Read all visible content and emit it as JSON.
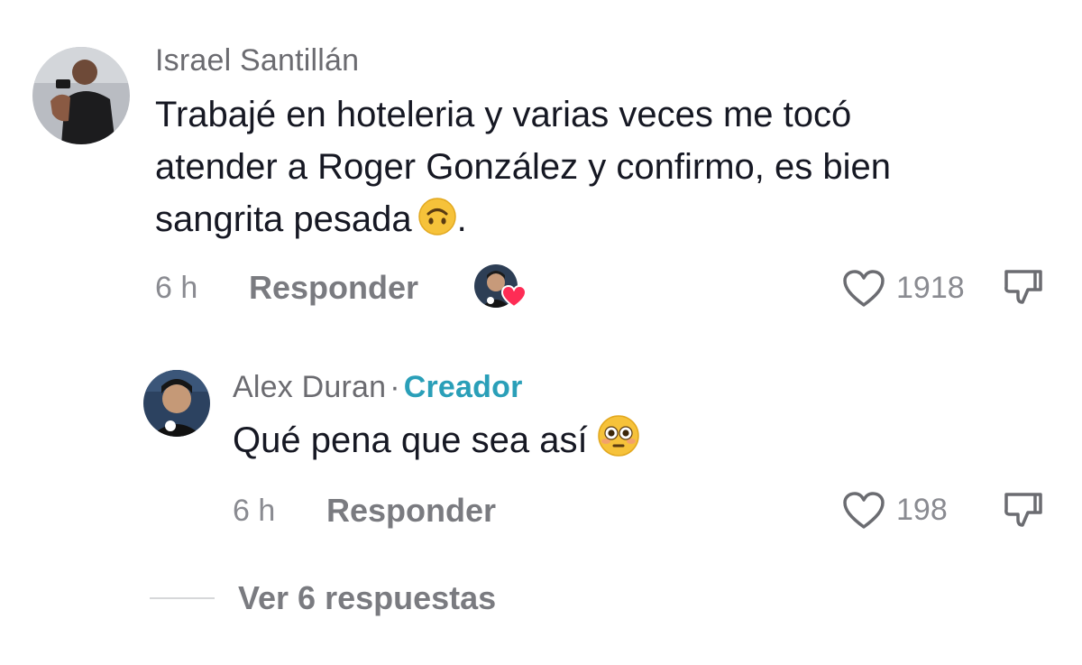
{
  "comment": {
    "author": "Israel Santillán",
    "text_lines": [
      "Trabajé en hoteleria y varias veces me tocó",
      "atender a Roger González y confirmo, es bien",
      "sangrita pesada"
    ],
    "text_suffix": ".",
    "emoji": "upside-down-face",
    "time": "6 h",
    "reply_label": "Responder",
    "likes": "1918"
  },
  "reply": {
    "author": "Alex Duran",
    "separator": "·",
    "creator_badge": "Creador",
    "text": "Qué pena que sea así",
    "emoji": "flushed-face",
    "time": "6 h",
    "reply_label": "Responder",
    "likes": "198"
  },
  "view_replies_label": "Ver 6 respuestas",
  "colors": {
    "creator": "#2a9fb8",
    "heart_badge": "#fe2c55",
    "text": "#161823",
    "muted": "#8a8b91"
  }
}
